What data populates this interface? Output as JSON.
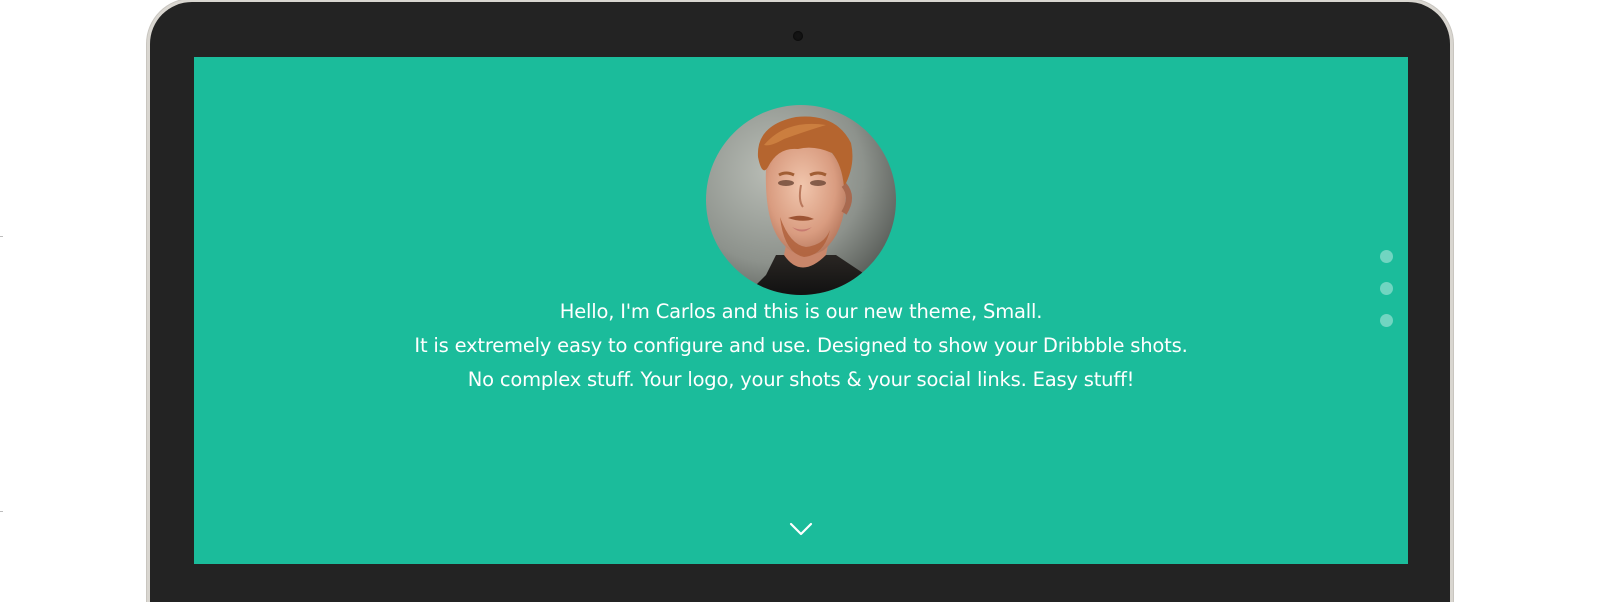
{
  "profile": {
    "avatar_icon": "person-portrait"
  },
  "intro": {
    "line1": "Hello, I'm Carlos and this is our new theme, Small.",
    "line2": "It is extremely easy to configure and use. Designed to show your Dribbble shots.",
    "line3": "No complex stuff. Your logo, your shots & your social links. Easy stuff!"
  },
  "section_nav": {
    "dots": 3,
    "dot_color": "rgba(255,255,255,0.38)"
  },
  "scroll_down": {
    "icon": "chevron-down-icon"
  },
  "colors": {
    "accent": "#1bbc9b",
    "bezel": "#232323",
    "text": "#ffffff"
  }
}
